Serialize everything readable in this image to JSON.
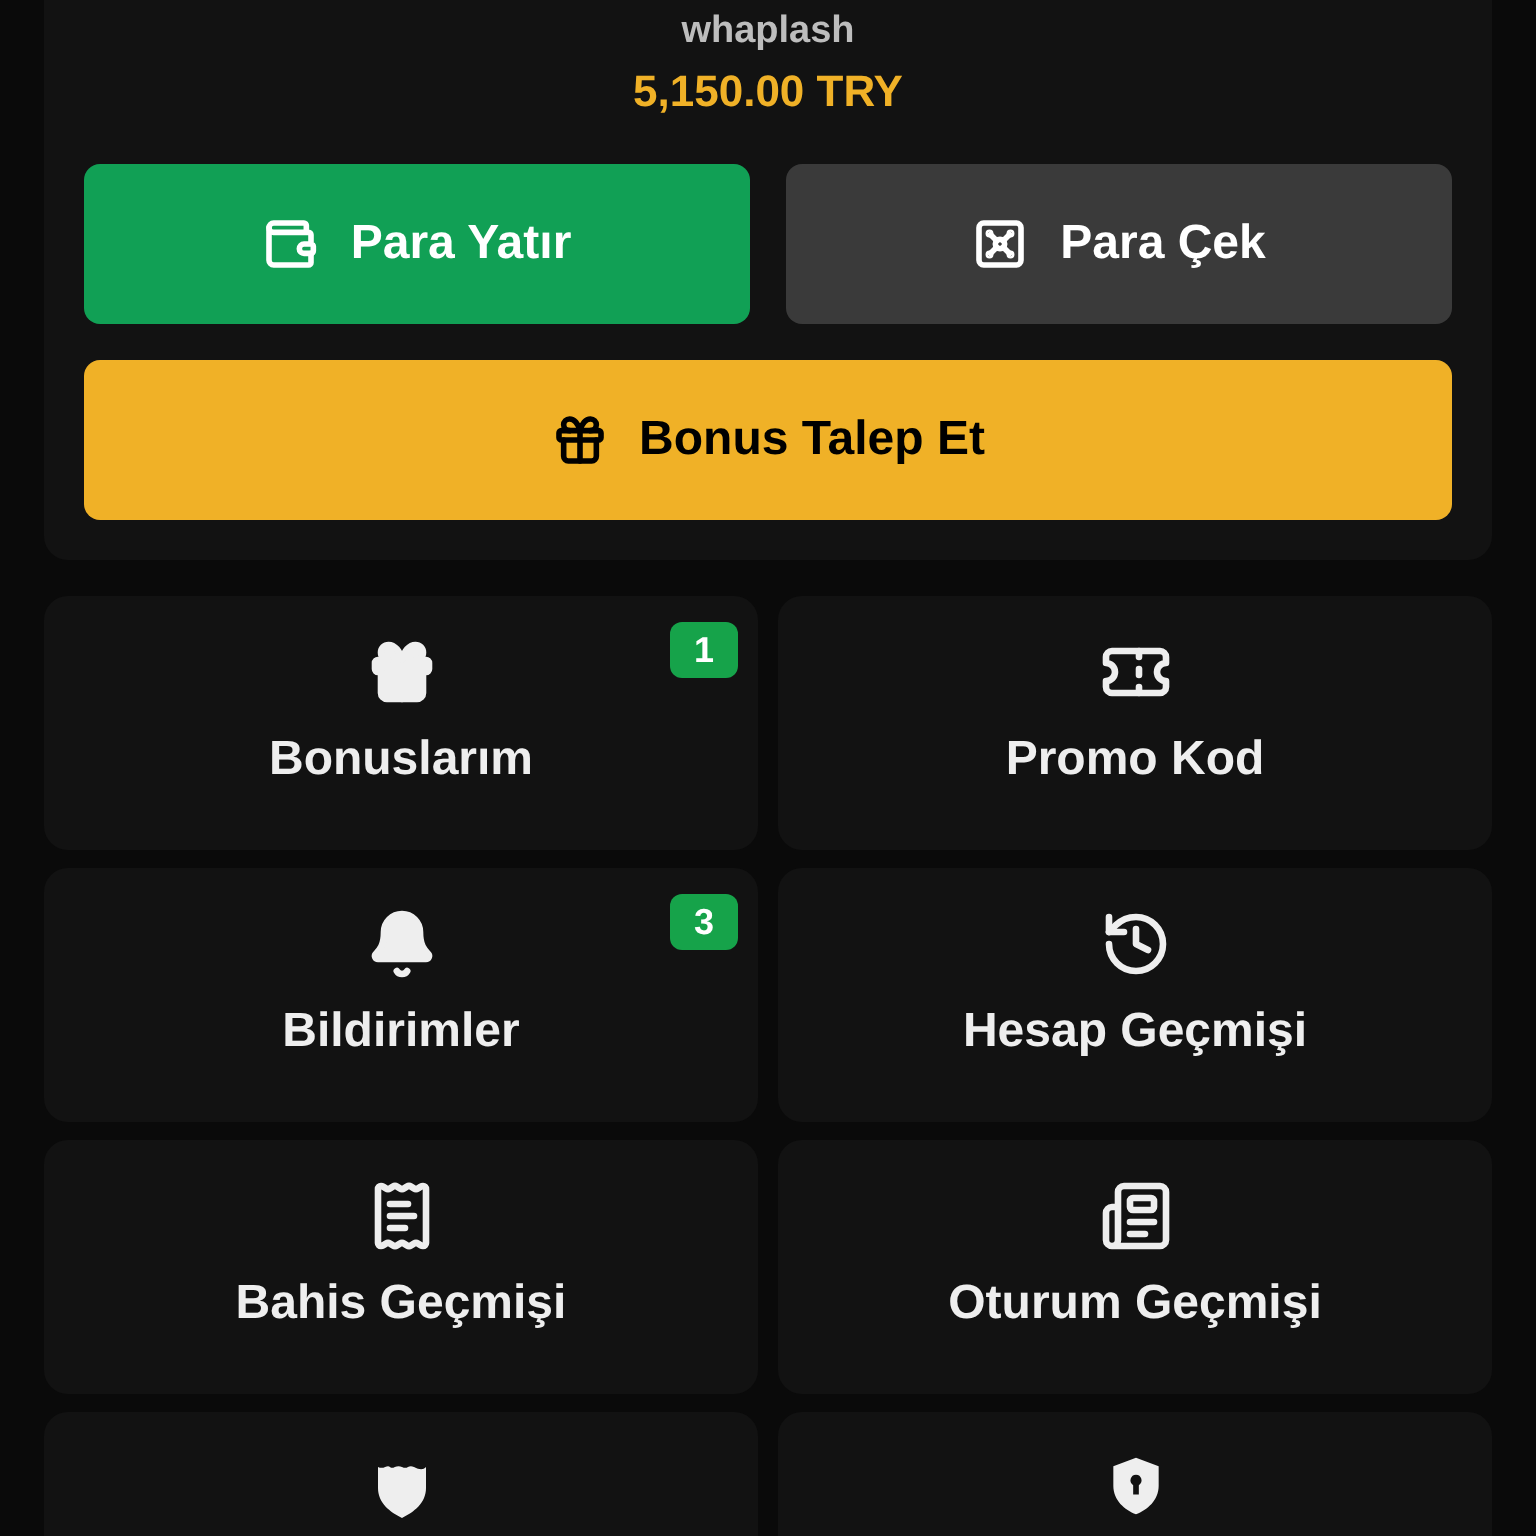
{
  "account": {
    "username": "whaplash",
    "balance": "5,150.00 TRY"
  },
  "actions": [
    {
      "kind": "deposit",
      "label": "Para Yatır"
    },
    {
      "kind": "withdraw",
      "label": "Para Çek"
    },
    {
      "kind": "bonus",
      "label": "Bonus Talep Et"
    }
  ],
  "menu": [
    {
      "kind": "gift",
      "label": "Bonuslarım",
      "badge": "1"
    },
    {
      "kind": "ticket",
      "label": "Promo Kod"
    },
    {
      "kind": "bell",
      "label": "Bildirimler",
      "badge": "3"
    },
    {
      "kind": "history",
      "label": "Hesap Geçmişi"
    },
    {
      "kind": "receipt",
      "label": "Bahis Geçmişi"
    },
    {
      "kind": "newspaper",
      "label": "Oturum Geçmişi"
    },
    {
      "kind": "shield"
    },
    {
      "kind": "keyhole"
    }
  ]
}
